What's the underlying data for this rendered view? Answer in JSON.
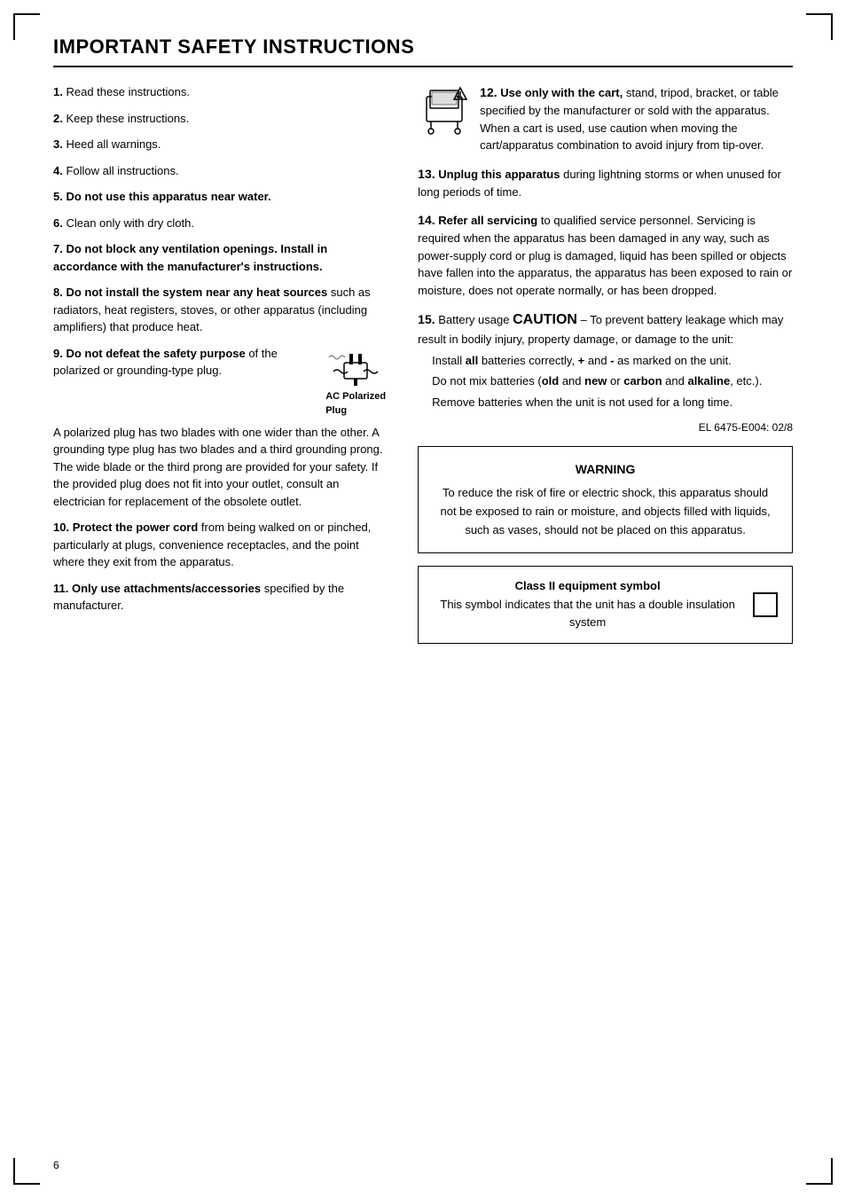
{
  "page": {
    "title": "IMPORTANT SAFETY INSTRUCTIONS",
    "page_number": "6",
    "el_number": "EL 6475-E004: 02/8"
  },
  "left_column": {
    "items": [
      {
        "num": "1.",
        "text": "Read these instructions."
      },
      {
        "num": "2.",
        "text": "Keep these instructions."
      },
      {
        "num": "3.",
        "text": "Heed all warnings."
      },
      {
        "num": "4.",
        "text": "Follow all instructions."
      },
      {
        "num": "5.",
        "bold_part": "Do not use this apparatus near water.",
        "rest": ""
      },
      {
        "num": "6.",
        "text": "Clean only with dry cloth."
      },
      {
        "num": "7.",
        "bold_part": "Do not block any ventilation openings. Install in accordance with the manufacturer's instructions.",
        "rest": ""
      },
      {
        "num": "8.",
        "bold_part": "Do not install the system near any heat sources",
        "rest": " such as radiators, heat registers, stoves, or other apparatus (including amplifiers) that produce heat."
      },
      {
        "num": "9.",
        "bold_part": "Do not defeat the safety purpose",
        "rest": " of the polarized or grounding-type plug.",
        "extra": "A polarized plug has two blades with one wider than the other. A grounding type plug has two blades and a third grounding prong. The wide blade or the third prong are provided for your safety. If the provided plug does not fit into your outlet, consult an electrician for replacement of the obsolete outlet."
      },
      {
        "num": "10.",
        "bold_part": "Protect the power cord",
        "rest": " from being walked on or pinched, particularly at plugs, convenience receptacles, and the point where they exit from the apparatus."
      },
      {
        "num": "11.",
        "bold_part": "Only use attachments/accessories",
        "rest": " specified by the manufacturer."
      }
    ]
  },
  "right_column": {
    "item12": {
      "num": "12.",
      "bold_part": "Use only with the cart,",
      "rest": " stand, tripod, bracket, or table specified by the manufacturer or sold with the apparatus. When a cart is used, use caution when moving the cart/apparatus combination to avoid injury from tip-over."
    },
    "item13": {
      "num": "13.",
      "bold_part": "Unplug this apparatus",
      "rest": " during lightning storms or when unused for long periods of time."
    },
    "item14": {
      "num": "14.",
      "bold_part": "Refer all servicing",
      "rest": " to qualified service personnel. Servicing is required when the apparatus has been damaged in any way, such as power-supply cord or plug is damaged, liquid has been spilled or objects have fallen into the apparatus, the apparatus has been exposed to rain or moisture, does not operate normally, or has been dropped."
    },
    "item15": {
      "num": "15.",
      "label": "Battery usage",
      "caution": "CAUTION",
      "dash": " – To prevent battery leakage which may result in bodily injury, property damage, or damage to the unit:",
      "bullets": [
        "Install all batteries correctly, + and - as marked on the unit.",
        "Do not mix batteries (old and new or carbon and alkaline, etc.).",
        "Remove batteries when the unit is not used for a long time."
      ]
    }
  },
  "warning_box": {
    "title": "WARNING",
    "text": "To reduce the risk of fire or electric shock, this apparatus should not be exposed to rain or moisture, and objects filled with liquids, such as vases, should not be placed on this apparatus."
  },
  "class2_box": {
    "title": "Class II equipment symbol",
    "description": "This symbol indicates that the unit has a double insulation system"
  },
  "ac_plug": {
    "label1": "AC Polarized",
    "label2": "Plug"
  }
}
